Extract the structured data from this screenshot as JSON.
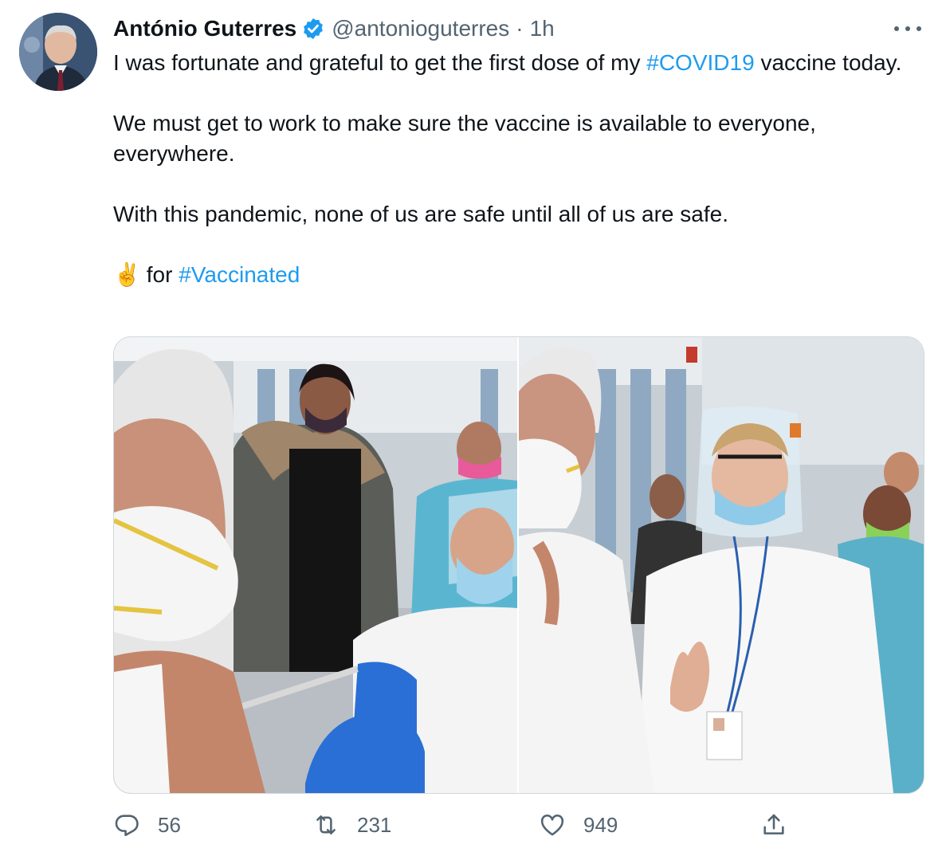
{
  "author": {
    "name": "António Guterres",
    "handle": "@antonioguterres",
    "separator": "·",
    "time": "1h",
    "verified": true
  },
  "tweet": {
    "line1_before": "I was fortunate and grateful to get the first dose of my ",
    "hashtag1": "#COVID19",
    "line1_after": " vaccine today.",
    "para2": "We must get to work to make sure the vaccine is available to everyone, everywhere.",
    "para3": "With this pandemic, none of us are safe until all of us are safe.",
    "emoji": "✌️",
    "para4_text": " for ",
    "hashtag2": "#Vaccinated"
  },
  "actions": {
    "replies": "56",
    "retweets": "231",
    "likes": "949"
  },
  "icons": {
    "more": "more-options-icon",
    "reply": "reply-icon",
    "retweet": "retweet-icon",
    "like": "heart-icon",
    "share": "share-icon",
    "verified": "verified-badge-icon"
  },
  "colors": {
    "hashtag": "#1d9bf0",
    "verified": "#1d9bf0",
    "muted": "#536471",
    "text": "#0f1419"
  }
}
